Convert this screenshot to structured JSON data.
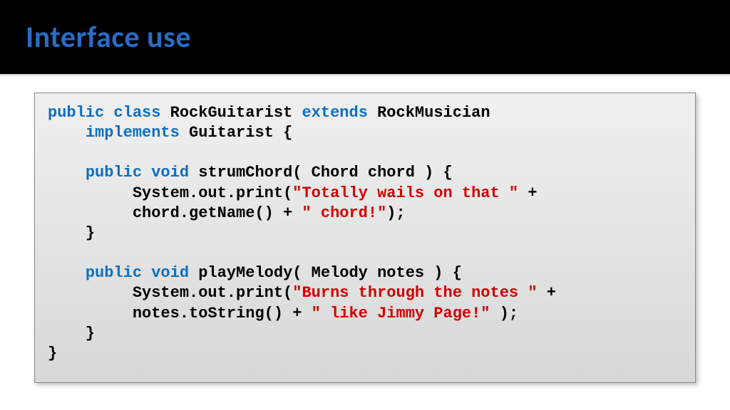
{
  "header": {
    "title": "Interface use"
  },
  "colors": {
    "keyword": "#0b6fc2",
    "string": "#d40000",
    "title": "#2a6bc6"
  },
  "code": {
    "tokens": [
      {
        "t": "kw",
        "v": "public class"
      },
      {
        "t": "p",
        "v": " RockGuitarist "
      },
      {
        "t": "kw",
        "v": "extends"
      },
      {
        "t": "p",
        "v": " RockMusician"
      },
      {
        "t": "nl"
      },
      {
        "t": "p",
        "v": "    "
      },
      {
        "t": "kw",
        "v": "implements"
      },
      {
        "t": "p",
        "v": " Guitarist {"
      },
      {
        "t": "nl"
      },
      {
        "t": "nl"
      },
      {
        "t": "p",
        "v": "    "
      },
      {
        "t": "kw",
        "v": "public void"
      },
      {
        "t": "p",
        "v": " strumChord( Chord chord ) {"
      },
      {
        "t": "nl"
      },
      {
        "t": "p",
        "v": "         System.out.print("
      },
      {
        "t": "str",
        "v": "\"Totally wails on that \""
      },
      {
        "t": "p",
        "v": " +"
      },
      {
        "t": "nl"
      },
      {
        "t": "p",
        "v": "         chord.getName() + "
      },
      {
        "t": "str",
        "v": "\" chord!\""
      },
      {
        "t": "p",
        "v": ");"
      },
      {
        "t": "nl"
      },
      {
        "t": "p",
        "v": "    }"
      },
      {
        "t": "nl"
      },
      {
        "t": "nl"
      },
      {
        "t": "p",
        "v": "    "
      },
      {
        "t": "kw",
        "v": "public void"
      },
      {
        "t": "p",
        "v": " playMelody( Melody notes ) {"
      },
      {
        "t": "nl"
      },
      {
        "t": "p",
        "v": "         System.out.print("
      },
      {
        "t": "str",
        "v": "\"Burns through the notes \""
      },
      {
        "t": "p",
        "v": " +"
      },
      {
        "t": "nl"
      },
      {
        "t": "p",
        "v": "         notes.toString() + "
      },
      {
        "t": "str",
        "v": "\" like Jimmy Page!\""
      },
      {
        "t": "p",
        "v": " );"
      },
      {
        "t": "nl"
      },
      {
        "t": "p",
        "v": "    }"
      },
      {
        "t": "nl"
      },
      {
        "t": "p",
        "v": "}"
      }
    ]
  }
}
